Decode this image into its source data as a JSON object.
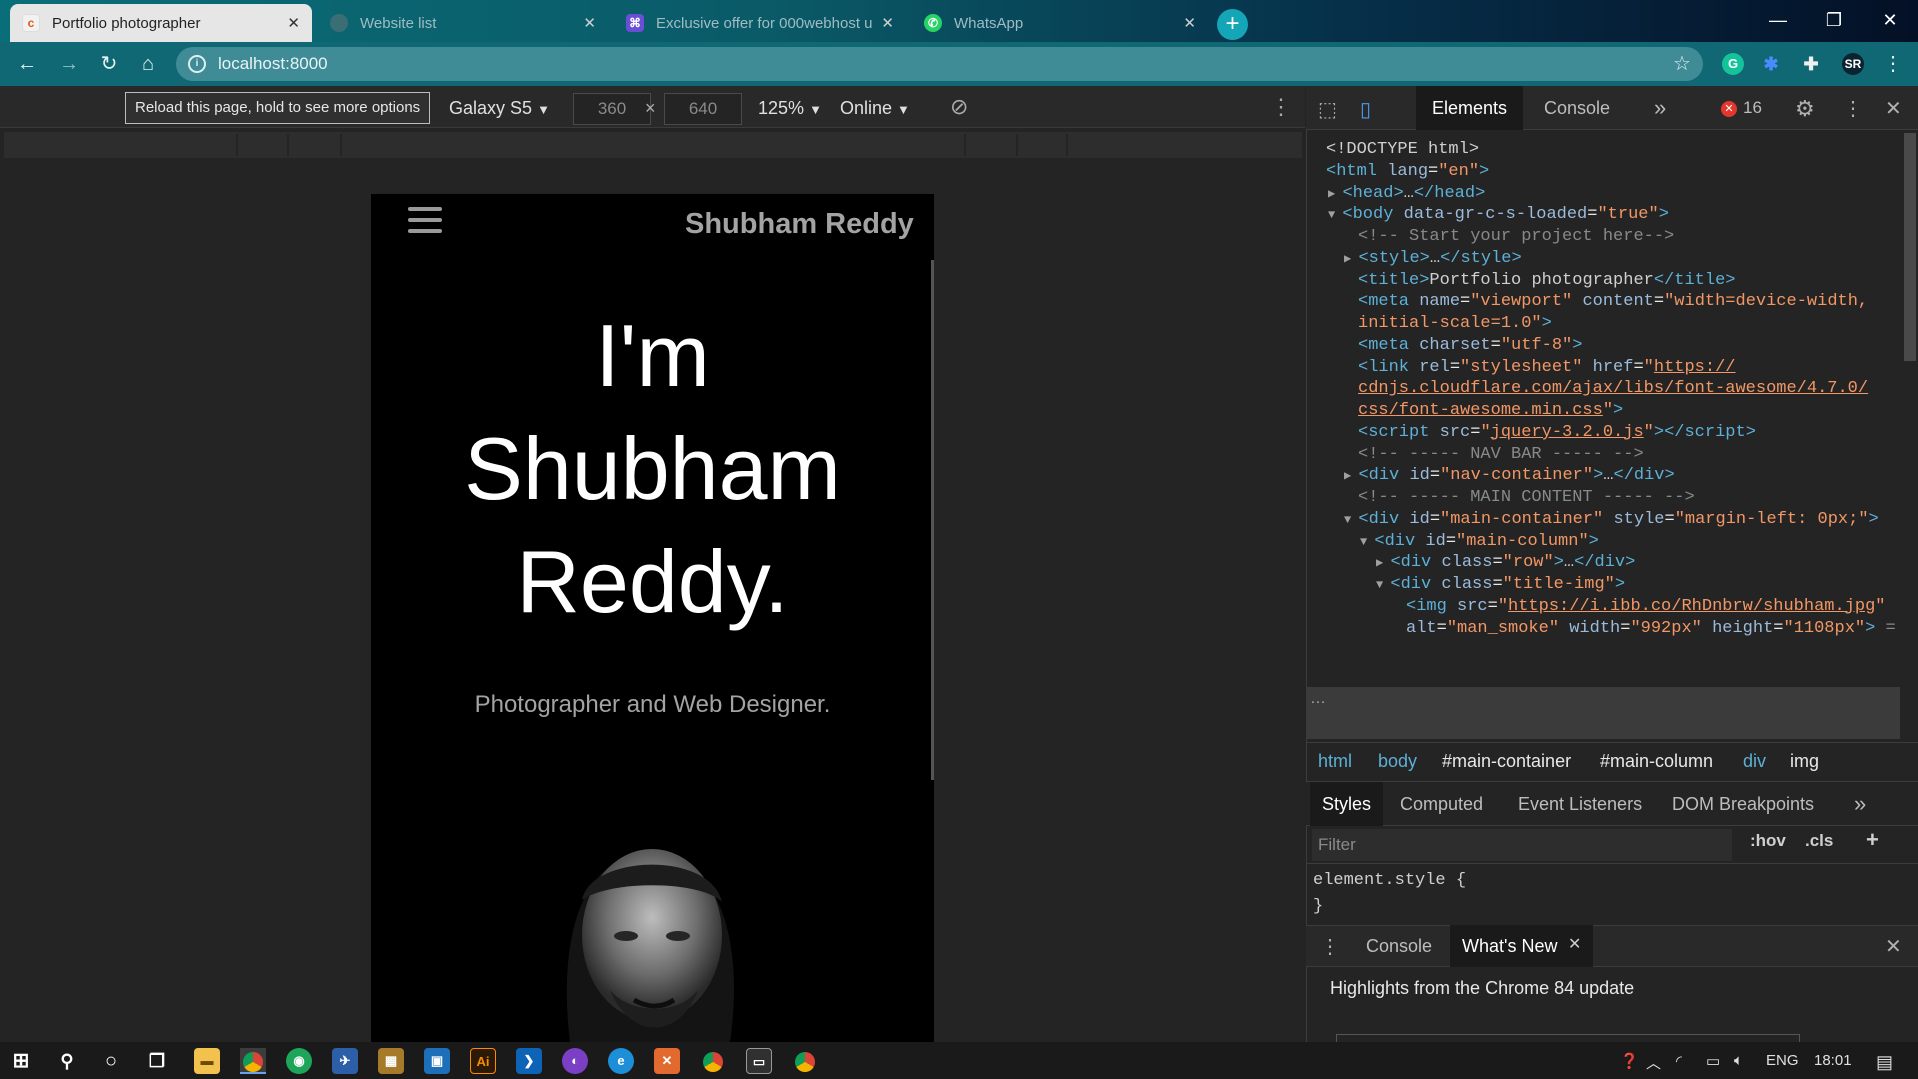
{
  "browser": {
    "tabs": [
      {
        "title": "Portfolio photographer",
        "active": true,
        "favicon": "letter-c-favicon"
      },
      {
        "title": "Website list",
        "active": false,
        "favicon": "globe-favicon"
      },
      {
        "title": "Exclusive offer for 000webhost u",
        "active": false,
        "favicon": "000webhost-favicon"
      },
      {
        "title": "WhatsApp",
        "active": false,
        "favicon": "whatsapp-favicon"
      }
    ],
    "new_tab": "+",
    "window_controls": {
      "minimize": "—",
      "restore": "❐",
      "close": "✕"
    },
    "url": "localhost:8000",
    "profile": "SR"
  },
  "device_toolbar": {
    "tooltip": "Reload this page, hold to see more options",
    "device": "Galaxy S5",
    "width": "360",
    "times": "×",
    "height": "640",
    "zoom": "125%",
    "network": "Online"
  },
  "site": {
    "brand": "Shubham Reddy",
    "hero": [
      "I'm",
      "Shubham",
      "Reddy."
    ],
    "subtitle": "Photographer and Web Designer."
  },
  "devtools": {
    "tabs": [
      "Elements",
      "Console"
    ],
    "more": "»",
    "error_count": "16",
    "dom_lines": [
      {
        "indent": 0,
        "tri": "",
        "html": "<span class='tx'>&lt;!DOCTYPE html&gt;</span>"
      },
      {
        "indent": 0,
        "tri": "",
        "html": "<span class='tg'>&lt;html</span> <span class='an'>lang</span>=<span class='av'>\"en\"</span><span class='tg'>&gt;</span>"
      },
      {
        "indent": 1,
        "tri": "▶",
        "html": "<span class='tg'>&lt;head&gt;</span><span class='tx'>…</span><span class='tg'>&lt;/head&gt;</span>"
      },
      {
        "indent": 1,
        "tri": "▼",
        "html": "<span class='tg'>&lt;body</span> <span class='an'>data-gr-c-s-loaded</span>=<span class='av'>\"true\"</span><span class='tg'>&gt;</span>"
      },
      {
        "indent": 2,
        "tri": "",
        "html": "<span class='cm'>&lt;!-- Start your project here--&gt;</span>"
      },
      {
        "indent": 2,
        "tri": "▶",
        "html": "<span class='tg'>&lt;style&gt;</span><span class='tx'>…</span><span class='tg'>&lt;/style&gt;</span>"
      },
      {
        "indent": 2,
        "tri": "",
        "html": "<span class='tg'>&lt;title&gt;</span><span class='tx'>Portfolio photographer</span><span class='tg'>&lt;/title&gt;</span>"
      },
      {
        "indent": 2,
        "tri": "",
        "html": "<span class='tg'>&lt;meta</span> <span class='an'>name</span>=<span class='av'>\"viewport\"</span> <span class='an'>content</span>=<span class='av'>\"width=device-width,</span>"
      },
      {
        "indent": 2,
        "tri": "",
        "html": "<span class='av'>initial-scale=1.0\"</span><span class='tg'>&gt;</span>"
      },
      {
        "indent": 2,
        "tri": "",
        "html": "<span class='tg'>&lt;meta</span> <span class='an'>charset</span>=<span class='av'>\"utf-8\"</span><span class='tg'>&gt;</span>"
      },
      {
        "indent": 2,
        "tri": "",
        "html": "<span class='tg'>&lt;link</span> <span class='an'>rel</span>=<span class='av'>\"stylesheet\"</span> <span class='an'>href</span>=<span class='av'>\"<span class='ul'>https://</span></span>"
      },
      {
        "indent": 2,
        "tri": "",
        "html": "<span class='av ul'>cdnjs.cloudflare.com/ajax/libs/font-awesome/4.7.0/</span>"
      },
      {
        "indent": 2,
        "tri": "",
        "html": "<span class='av'><span class='ul'>css/font-awesome.min.css</span>\"</span><span class='tg'>&gt;</span>"
      },
      {
        "indent": 2,
        "tri": "",
        "html": "<span class='tg'>&lt;script</span> <span class='an'>src</span>=<span class='av'>\"<span class='ul'>jquery-3.2.0.js</span>\"</span><span class='tg'>&gt;&lt;/script&gt;</span>"
      },
      {
        "indent": 2,
        "tri": "",
        "html": "<span class='cm'>&lt;!-- ----- NAV BAR ----- --&gt;</span>"
      },
      {
        "indent": 2,
        "tri": "▶",
        "html": "<span class='tg'>&lt;div</span> <span class='an'>id</span>=<span class='av'>\"nav-container\"</span><span class='tg'>&gt;</span><span class='tx'>…</span><span class='tg'>&lt;/div&gt;</span>"
      },
      {
        "indent": 2,
        "tri": "",
        "html": "<span class='cm'>&lt;!-- ----- MAIN CONTENT ----- --&gt;</span>"
      },
      {
        "indent": 2,
        "tri": "▼",
        "html": "<span class='tg'>&lt;div</span> <span class='an'>id</span>=<span class='av'>\"main-container\"</span> <span class='an'>style</span>=<span class='av'>\"margin-left: 0px;\"</span><span class='tg'>&gt;</span>"
      },
      {
        "indent": 3,
        "tri": "▼",
        "html": "<span class='tg'>&lt;div</span> <span class='an'>id</span>=<span class='av'>\"main-column\"</span><span class='tg'>&gt;</span>"
      },
      {
        "indent": 4,
        "tri": "▶",
        "html": "<span class='tg'>&lt;div</span> <span class='an'>class</span>=<span class='av'>\"row\"</span><span class='tg'>&gt;</span><span class='tx'>…</span><span class='tg'>&lt;/div&gt;</span>"
      },
      {
        "indent": 4,
        "tri": "▼",
        "html": "<span class='tg'>&lt;div</span> <span class='an'>class</span>=<span class='av'>\"title-img\"</span><span class='tg'>&gt;</span>"
      },
      {
        "indent": 5,
        "tri": "",
        "html": "<span class='tg'>&lt;img</span> <span class='an'>src</span>=<span class='av'>\"<span class='ul'>https://i.ibb.co/RhDnbrw/shubham.jpg</span>\"</span>"
      },
      {
        "indent": 5,
        "tri": "",
        "html": "<span class='an'>alt</span>=<span class='av'>\"man_smoke\"</span> <span class='an'>width</span>=<span class='av'>\"992px\"</span> <span class='an'>height</span>=<span class='av'>\"1108px\"</span><span class='tg'>&gt;</span> <span class='cm'>=</span>"
      }
    ],
    "breadcrumbs": [
      "html",
      "body",
      "#main-container",
      "#main-column",
      "div",
      "img"
    ],
    "style_tabs": [
      "Styles",
      "Computed",
      "Event Listeners",
      "DOM Breakpoints"
    ],
    "filter_placeholder": "Filter",
    "hov": ":hov",
    "cls": ".cls",
    "add": "+",
    "element_style": "element.style {",
    "element_style_close": "}",
    "drawer_tabs": [
      "Console",
      "What's New"
    ],
    "drawer_highlights": "Highlights from the Chrome 84 update"
  },
  "taskbar": {
    "lang": "ENG",
    "time": "18:01"
  }
}
